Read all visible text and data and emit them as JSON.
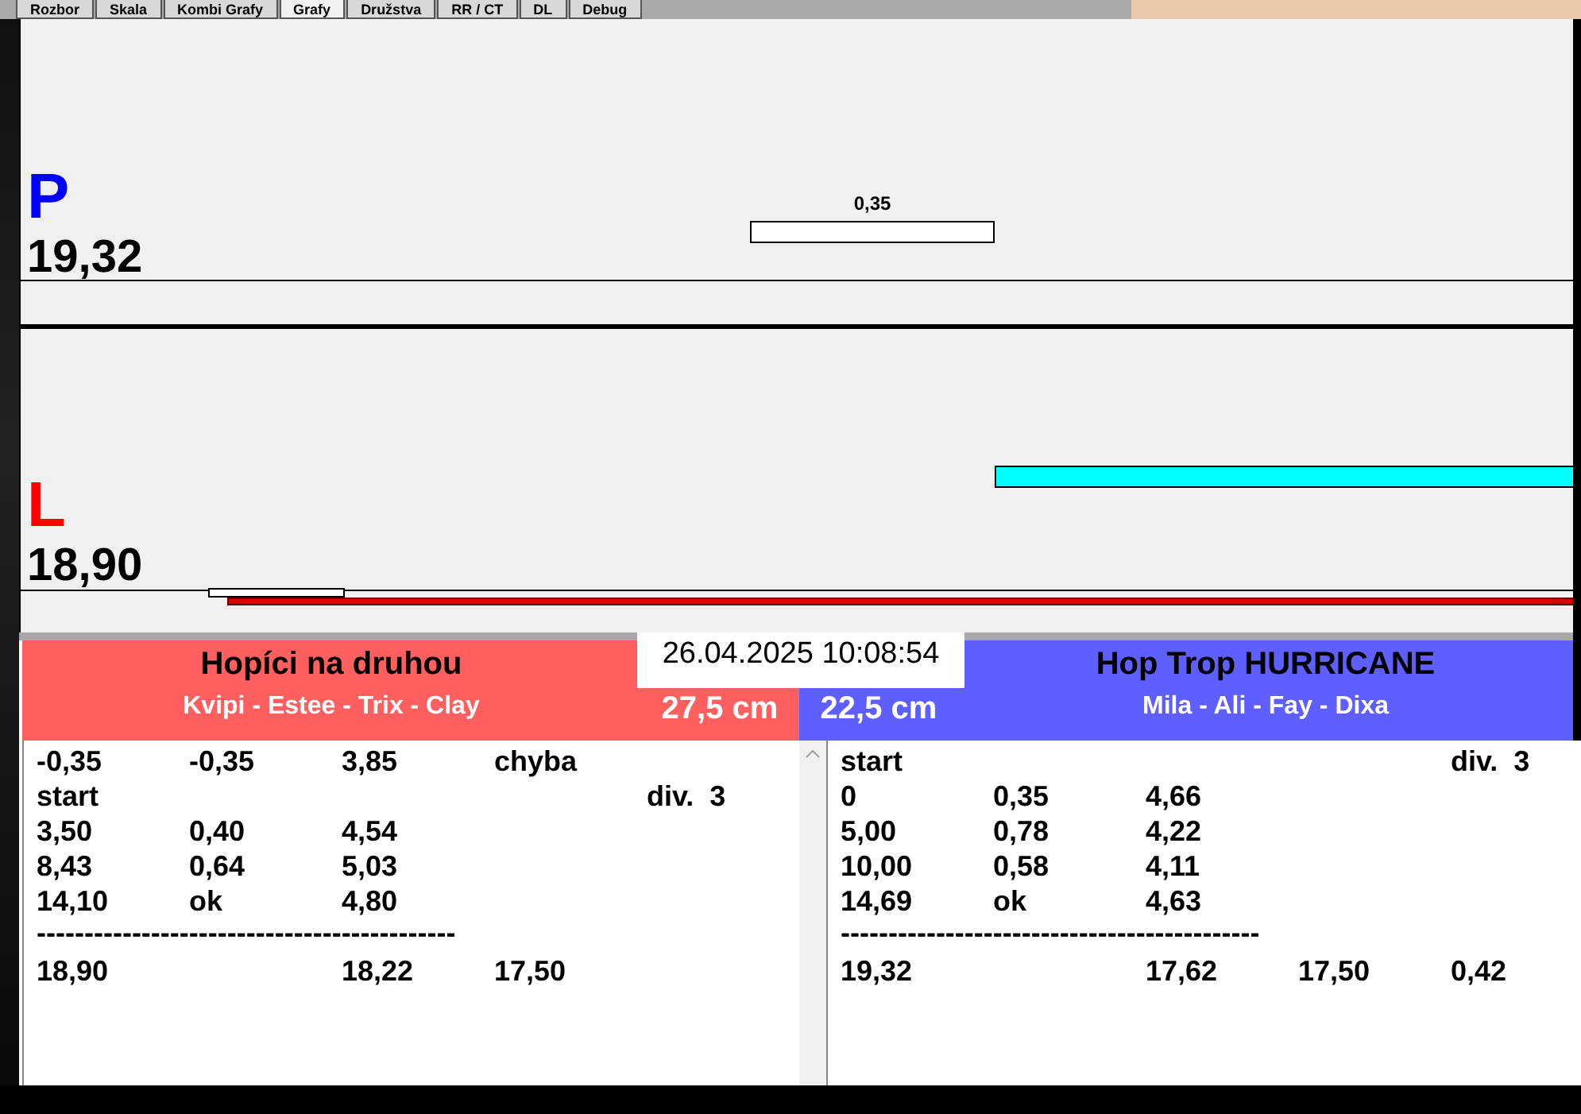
{
  "tabs": [
    {
      "label": "Rozbor",
      "selected": false
    },
    {
      "label": "Skala",
      "selected": false
    },
    {
      "label": "Kombi Grafy",
      "selected": false
    },
    {
      "label": "Grafy",
      "selected": true
    },
    {
      "label": "Družstva",
      "selected": false
    },
    {
      "label": "RR / CT",
      "selected": false
    },
    {
      "label": "DL",
      "selected": false
    },
    {
      "label": "Debug",
      "selected": false
    }
  ],
  "panels": [
    {
      "kind": "upper",
      "letter": "P",
      "color": "#0000ff",
      "score": "19,32",
      "bar_label": "0,35"
    },
    {
      "kind": "lower",
      "letter": "L",
      "color": "#ff0000",
      "score": "18,90"
    }
  ],
  "timestamp": "26.04.2025 10:08:54",
  "teams": [
    {
      "name": "Hopíci na druhou",
      "members": "Kvipi - Estee - Trix - Clay",
      "distance": "27,5 cm",
      "color": "#ff5f5f",
      "rows": [
        {
          "column_1": "-0,35",
          "column_2": "-0,35",
          "column_3": "3,85",
          "column_4": "chyba"
        },
        {
          "column_1": "start",
          "column_5": "div.  3"
        },
        {
          "column_1": "3,50",
          "column_2": "0,40",
          "column_3": "4,54"
        },
        {
          "column_1": "8,43",
          "column_2": "0,64",
          "column_3": "5,03"
        },
        {
          "column_1": "14,10",
          "column_2": "ok",
          "column_3": "4,80"
        },
        {
          "kind": "separator",
          "text": "--------------------------------------------"
        },
        {
          "column_1": "18,90",
          "column_3": "18,22",
          "column_4": "17,50"
        }
      ]
    },
    {
      "name": "Hop Trop HURRICANE",
      "members": "Mila - Ali - Fay - Dixa",
      "distance": "22,5 cm",
      "color": "#5f5fff",
      "rows": [
        {
          "column_1": "start",
          "column_5": "div.  3"
        },
        {
          "column_1": "0",
          "column_2": "0,35",
          "column_3": "4,66"
        },
        {
          "column_1": "5,00",
          "column_2": "0,78",
          "column_3": "4,22"
        },
        {
          "column_1": "10,00",
          "column_2": "0,58",
          "column_3": "4,11"
        },
        {
          "column_1": "14,69",
          "column_2": "ok",
          "column_3": "4,63"
        },
        {
          "kind": "separator",
          "text": "--------------------------------------------"
        },
        {
          "column_1": "19,32",
          "column_3": "17,62",
          "column_4": "17,50",
          "column_5": "0,42"
        }
      ]
    }
  ]
}
